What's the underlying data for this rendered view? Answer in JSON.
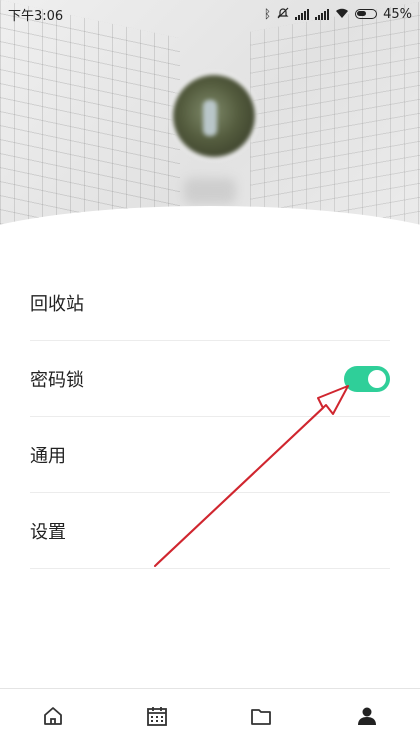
{
  "status_bar": {
    "time": "下午3:06",
    "battery_percent": "45%",
    "icons": [
      "bluetooth-icon",
      "mute-icon",
      "signal-icon",
      "signal-icon",
      "wifi-icon",
      "battery-icon"
    ]
  },
  "profile": {
    "avatar_icon": "avatar-blurred"
  },
  "menu": {
    "items": [
      {
        "label": "回收站"
      },
      {
        "label": "密码锁",
        "toggle_on": true
      },
      {
        "label": "通用"
      },
      {
        "label": "设置"
      }
    ]
  },
  "bottom_nav": {
    "items": [
      {
        "icon": "home-icon"
      },
      {
        "icon": "calendar-icon"
      },
      {
        "icon": "folder-icon"
      },
      {
        "icon": "profile-icon"
      }
    ]
  },
  "colors": {
    "toggle_on": "#2fcf99",
    "annotation_arrow": "#d0262f"
  }
}
